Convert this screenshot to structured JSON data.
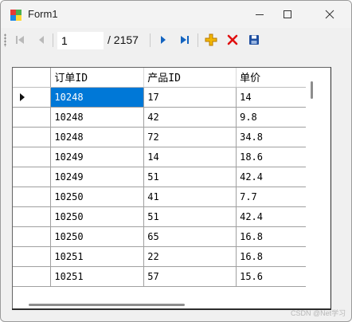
{
  "window": {
    "title": "Form1"
  },
  "navigator": {
    "position_value": "1",
    "count_label": "/ 2157"
  },
  "grid": {
    "columns": [
      "订单ID",
      "产品ID",
      "单价"
    ],
    "rows": [
      [
        "10248",
        "17",
        "14"
      ],
      [
        "10248",
        "42",
        "9.8"
      ],
      [
        "10248",
        "72",
        "34.8"
      ],
      [
        "10249",
        "14",
        "18.6"
      ],
      [
        "10249",
        "51",
        "42.4"
      ],
      [
        "10250",
        "41",
        "7.7"
      ],
      [
        "10250",
        "51",
        "42.4"
      ],
      [
        "10250",
        "65",
        "16.8"
      ],
      [
        "10251",
        "22",
        "16.8"
      ],
      [
        "10251",
        "57",
        "15.6"
      ]
    ],
    "selected_row": 0
  },
  "watermark": "CSDN @Net学习",
  "colors": {
    "selection": "#0078d7",
    "add_icon": "#e8a000",
    "delete_icon": "#e01010",
    "nav_icon": "#1464c0"
  }
}
